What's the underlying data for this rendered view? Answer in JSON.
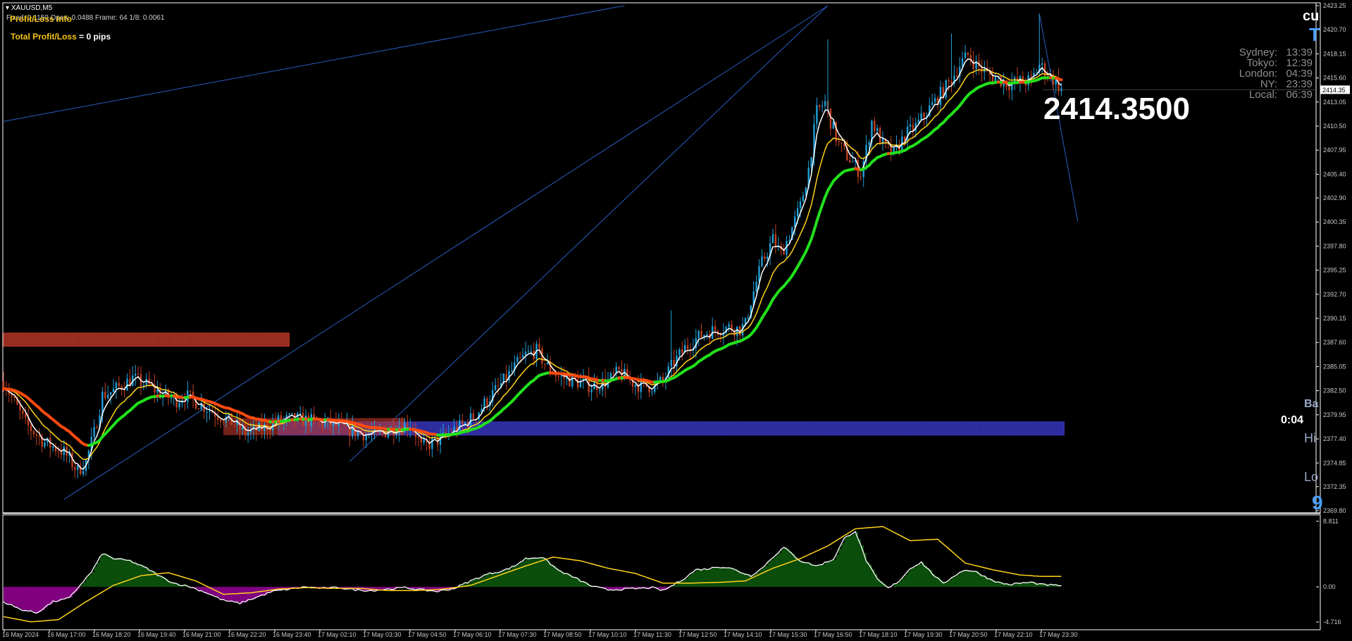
{
  "header": {
    "symbol": "XAUUSD,M5",
    "info": "Fixed: 0.1150  Open: 0.0488   Frame: 64   1/8: 0.0061"
  },
  "profit_loss": {
    "title": "Profit/Loss Info",
    "total_label": "Total Profit/Loss",
    "total_value": "= 0 pips"
  },
  "big_price": "2414.3500",
  "clocks": [
    {
      "city": "Sydney:",
      "time": "13:39"
    },
    {
      "city": "Tokyo:",
      "time": "12:39"
    },
    {
      "city": "London:",
      "time": "04:39"
    },
    {
      "city": "NY:",
      "time": "23:39"
    },
    {
      "city": "Local:",
      "time": "06:39"
    }
  ],
  "timer": "0:04",
  "right_fragments": {
    "top_a": "cu",
    "top_b": "T",
    "ba": "Ba",
    "hi": "Hi",
    "lo": "Lo",
    "nine": "9"
  },
  "colors": {
    "bg": "#000000",
    "candle_up": "#1fa0d8",
    "candle_down": "#c2401f",
    "ma_fast": "#ffffff",
    "ma_mid": "#ffd21a",
    "ma_slow_up": "#22e01c",
    "ma_slow_down": "#ff4a10",
    "channel": "#2a5cc0",
    "resistance_zone": "#c0382a",
    "support_zone": "#3a38c8",
    "osc_pos": "#0b4d0b",
    "osc_neg": "#800080",
    "osc_line": "#ffd21a",
    "osc_white": "#ffffff"
  },
  "chart_data": [
    {
      "type": "line",
      "title": "",
      "symbol": "XAUUSD",
      "timeframe": "M5",
      "x_ticks": [
        "16 May 2024",
        "16 May 17:00",
        "16 May 18:20",
        "16 May 19:40",
        "16 May 21:00",
        "16 May 22:20",
        "16 May 23:40",
        "17 May 02:10",
        "17 May 03:30",
        "17 May 04:50",
        "17 May 06:10",
        "17 May 07:30",
        "17 May 08:50",
        "17 May 10:10",
        "17 May 11:30",
        "17 May 12:50",
        "17 May 14:10",
        "17 May 15:30",
        "17 May 16:50",
        "17 May 18:10",
        "17 May 19:30",
        "17 May 20:50",
        "17 May 22:10",
        "17 May 23:30"
      ],
      "y_ticks": [
        "2423.25",
        "2420.70",
        "2418.15",
        "2415.60",
        "2413.05",
        "2410.50",
        "2407.95",
        "2405.40",
        "2402.90",
        "2400.35",
        "2397.80",
        "2395.25",
        "2392.70",
        "2390.15",
        "2387.60",
        "2385.05",
        "2382.50",
        "2379.95",
        "2377.40",
        "2374.85",
        "2372.35",
        "2369.80"
      ],
      "ylim": [
        2369.8,
        2423.25
      ],
      "current_price": "2414.35",
      "price_path": [
        [
          0,
          2383.5
        ],
        [
          8,
          2379
        ],
        [
          15,
          2377
        ],
        [
          22,
          2376
        ],
        [
          27,
          2374
        ],
        [
          30,
          2375
        ],
        [
          33,
          2378
        ],
        [
          36,
          2382
        ],
        [
          40,
          2382.5
        ],
        [
          47,
          2383.8
        ],
        [
          53,
          2383
        ],
        [
          58,
          2382
        ],
        [
          63,
          2381.5
        ],
        [
          66,
          2382
        ],
        [
          72,
          2381
        ],
        [
          78,
          2380
        ],
        [
          84,
          2379
        ],
        [
          88,
          2378
        ],
        [
          94,
          2378.5
        ],
        [
          100,
          2379.3
        ],
        [
          106,
          2379.5
        ],
        [
          112,
          2379.3
        ],
        [
          118,
          2379
        ],
        [
          124,
          2378.5
        ],
        [
          130,
          2378
        ],
        [
          136,
          2377.8
        ],
        [
          140,
          2378.3
        ],
        [
          144,
          2378.8
        ],
        [
          148,
          2379
        ],
        [
          150,
          2378
        ],
        [
          152,
          2376.5
        ],
        [
          156,
          2377
        ],
        [
          160,
          2377.5
        ],
        [
          163,
          2378.2
        ],
        [
          168,
          2379
        ],
        [
          172,
          2380
        ],
        [
          176,
          2381.5
        ],
        [
          182,
          2383.5
        ],
        [
          186,
          2385
        ],
        [
          190,
          2386.3
        ],
        [
          194,
          2386.7
        ],
        [
          198,
          2385
        ],
        [
          202,
          2384
        ],
        [
          208,
          2383.5
        ],
        [
          214,
          2383
        ],
        [
          220,
          2383.5
        ],
        [
          224,
          2384.5
        ],
        [
          228,
          2383.5
        ],
        [
          232,
          2383
        ],
        [
          236,
          2383
        ],
        [
          240,
          2383.5
        ],
        [
          244,
          2385.5
        ],
        [
          248,
          2387
        ],
        [
          252,
          2388
        ],
        [
          256,
          2388.7
        ],
        [
          260,
          2389
        ],
        [
          264,
          2389.2
        ],
        [
          268,
          2389
        ],
        [
          270,
          2389.5
        ],
        [
          272,
          2392
        ],
        [
          276,
          2396
        ],
        [
          280,
          2398.5
        ],
        [
          283,
          2397
        ],
        [
          286,
          2399
        ],
        [
          290,
          2402
        ],
        [
          293,
          2406
        ],
        [
          296,
          2412
        ],
        [
          299,
          2413
        ],
        [
          301,
          2411
        ],
        [
          304,
          2408.5
        ],
        [
          308,
          2407
        ],
        [
          312,
          2405.5
        ],
        [
          314,
          2408
        ],
        [
          316,
          2411
        ],
        [
          320,
          2408.5
        ],
        [
          324,
          2407.5
        ],
        [
          328,
          2409.5
        ],
        [
          332,
          2410.5
        ],
        [
          336,
          2412
        ],
        [
          340,
          2413.5
        ],
        [
          344,
          2415
        ],
        [
          348,
          2417
        ],
        [
          351,
          2418
        ],
        [
          354,
          2417
        ],
        [
          358,
          2416
        ],
        [
          362,
          2415.5
        ],
        [
          366,
          2415
        ],
        [
          370,
          2415.2
        ],
        [
          374,
          2415.3
        ],
        [
          377,
          2417
        ],
        [
          380,
          2416
        ],
        [
          383,
          2415.2
        ],
        [
          385,
          2414.35
        ]
      ],
      "series": [
        {
          "name": "",
          "color": "#ffffff",
          "role": "fast moving average"
        },
        {
          "name": "",
          "color": "#ffd21a",
          "role": "medium moving average"
        },
        {
          "name": "",
          "color": "#22e01c",
          "role": "slow moving average (rising)"
        },
        {
          "name": "",
          "color": "#ff4a10",
          "role": "slow moving average (falling)"
        }
      ],
      "zones": [
        {
          "kind": "resistance",
          "price_top": 2388.6,
          "price_bottom": 2387.2,
          "x_start": 0,
          "x_end": 104
        },
        {
          "kind": "support",
          "price_top": 2379.2,
          "price_bottom": 2377.8,
          "x_start": 100,
          "x_end": 386
        }
      ],
      "grid": false,
      "legend": "none"
    },
    {
      "type": "area",
      "title": "",
      "y_ticks": [
        "8.811",
        "0.00",
        "-4.716"
      ],
      "ylim": [
        -4.716,
        8.811
      ],
      "osc_path": [
        [
          0,
          -2
        ],
        [
          6,
          -3
        ],
        [
          12,
          -3.5
        ],
        [
          18,
          -2
        ],
        [
          24,
          -1.5
        ],
        [
          28,
          0.3
        ],
        [
          32,
          2
        ],
        [
          36,
          4.5
        ],
        [
          40,
          3.8
        ],
        [
          46,
          3.5
        ],
        [
          52,
          2.5
        ],
        [
          58,
          1.2
        ],
        [
          62,
          0.5
        ],
        [
          68,
          0
        ],
        [
          74,
          -0.8
        ],
        [
          80,
          -1.8
        ],
        [
          86,
          -2.2
        ],
        [
          92,
          -1.4
        ],
        [
          98,
          -0.6
        ],
        [
          104,
          -0.3
        ],
        [
          110,
          0
        ],
        [
          116,
          -0.2
        ],
        [
          122,
          -0.1
        ],
        [
          128,
          -0.4
        ],
        [
          134,
          -0.5
        ],
        [
          140,
          -0.3
        ],
        [
          146,
          -0.1
        ],
        [
          152,
          -0.4
        ],
        [
          158,
          -0.6
        ],
        [
          164,
          -0.2
        ],
        [
          170,
          0.8
        ],
        [
          176,
          1.7
        ],
        [
          182,
          2.2
        ],
        [
          186,
          2.8
        ],
        [
          190,
          3.8
        ],
        [
          196,
          4
        ],
        [
          202,
          2.2
        ],
        [
          208,
          1.2
        ],
        [
          214,
          0.1
        ],
        [
          220,
          -0.4
        ],
        [
          226,
          -0.3
        ],
        [
          232,
          -0.2
        ],
        [
          236,
          -0.1
        ],
        [
          240,
          -0.5
        ],
        [
          244,
          0.3
        ],
        [
          248,
          1.2
        ],
        [
          252,
          2.3
        ],
        [
          256,
          2.4
        ],
        [
          260,
          2.7
        ],
        [
          264,
          2.6
        ],
        [
          268,
          2
        ],
        [
          272,
          1.5
        ],
        [
          276,
          2.5
        ],
        [
          280,
          4
        ],
        [
          284,
          5.3
        ],
        [
          290,
          3.5
        ],
        [
          296,
          2.8
        ],
        [
          302,
          3.7
        ],
        [
          306,
          6.5
        ],
        [
          310,
          7.5
        ],
        [
          314,
          3.5
        ],
        [
          318,
          1
        ],
        [
          322,
          -0.2
        ],
        [
          326,
          0.8
        ],
        [
          330,
          2.5
        ],
        [
          334,
          3.3
        ],
        [
          338,
          1.8
        ],
        [
          342,
          0.4
        ],
        [
          346,
          1.5
        ],
        [
          350,
          2.3
        ],
        [
          354,
          2
        ],
        [
          358,
          1.2
        ],
        [
          362,
          0.6
        ],
        [
          366,
          0.3
        ],
        [
          370,
          0.5
        ],
        [
          374,
          0.6
        ],
        [
          378,
          0.3
        ],
        [
          383,
          0.2
        ]
      ],
      "signal_path": [
        [
          0,
          -4
        ],
        [
          10,
          -4.7
        ],
        [
          20,
          -4.4
        ],
        [
          30,
          -2
        ],
        [
          40,
          0.2
        ],
        [
          50,
          1.5
        ],
        [
          60,
          1.9
        ],
        [
          70,
          0.8
        ],
        [
          80,
          -1
        ],
        [
          90,
          -0.8
        ],
        [
          100,
          -0.3
        ],
        [
          110,
          -0.1
        ],
        [
          120,
          -0.2
        ],
        [
          130,
          -0.2
        ],
        [
          140,
          -0.5
        ],
        [
          150,
          -0.5
        ],
        [
          160,
          -0.3
        ],
        [
          170,
          0.2
        ],
        [
          180,
          1.5
        ],
        [
          190,
          2.8
        ],
        [
          200,
          4
        ],
        [
          210,
          3.5
        ],
        [
          220,
          2.5
        ],
        [
          230,
          1.8
        ],
        [
          240,
          0.5
        ],
        [
          250,
          0.5
        ],
        [
          260,
          0.6
        ],
        [
          270,
          0.8
        ],
        [
          280,
          2.5
        ],
        [
          290,
          3.8
        ],
        [
          300,
          5.5
        ],
        [
          310,
          7.8
        ],
        [
          320,
          8.1
        ],
        [
          330,
          6.2
        ],
        [
          340,
          6.4
        ],
        [
          350,
          3.2
        ],
        [
          360,
          2.3
        ],
        [
          370,
          1.6
        ],
        [
          378,
          1.4
        ],
        [
          383,
          1.4
        ]
      ],
      "legend": "none",
      "grid": false
    }
  ]
}
